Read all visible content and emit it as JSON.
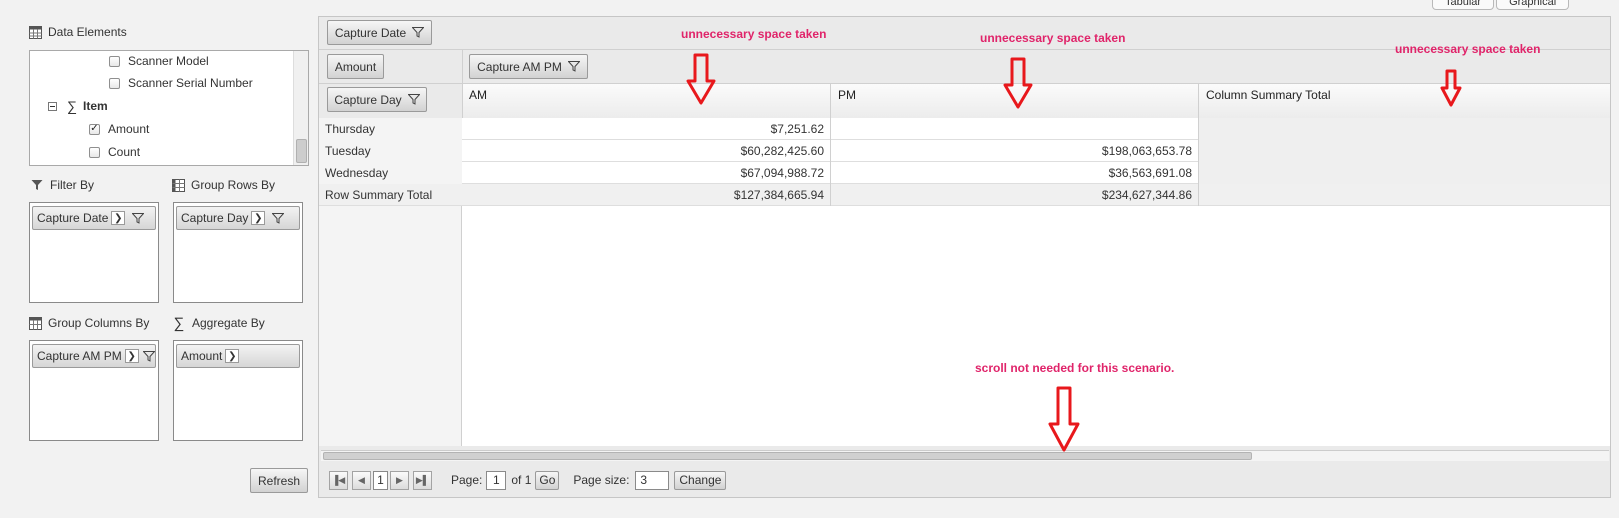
{
  "top_tabs": [
    "Tabular",
    "Graphical"
  ],
  "data_elements": {
    "title": "Data Elements",
    "items": [
      {
        "label": "Scanner Model",
        "checked": false
      },
      {
        "label": "Scanner Serial Number",
        "checked": false
      },
      {
        "label": "Item",
        "group": true
      },
      {
        "label": "Amount",
        "checked": true
      },
      {
        "label": "Count",
        "checked": false
      }
    ]
  },
  "filter_by": {
    "title": "Filter By",
    "chip": "Capture Date"
  },
  "group_rows_by": {
    "title": "Group Rows By",
    "chip": "Capture Day"
  },
  "group_columns_by": {
    "title": "Group Columns By",
    "chip": "Capture AM PM"
  },
  "aggregate_by": {
    "title": "Aggregate By",
    "chip": "Amount"
  },
  "refresh_label": "Refresh",
  "pivot": {
    "filter_chip": "Capture Date",
    "aggregate_chip": "Amount",
    "column_chip": "Capture AM PM",
    "row_chip": "Capture Day",
    "column_headers": [
      "AM",
      "PM",
      "Column Summary Total"
    ],
    "rows": [
      {
        "label": "Thursday",
        "am": "$7,251.62",
        "pm": ""
      },
      {
        "label": "Tuesday",
        "am": "$60,282,425.60",
        "pm": "$198,063,653.78"
      },
      {
        "label": "Wednesday",
        "am": "$67,094,988.72",
        "pm": "$36,563,691.08"
      },
      {
        "label": "Row Summary Total",
        "am": "$127,384,665.94",
        "pm": "$234,627,344.86"
      }
    ]
  },
  "pager": {
    "current_page": "1",
    "page_label": "Page:",
    "page_value": "1",
    "of_label": "of 1",
    "go_label": "Go",
    "page_size_label": "Page size:",
    "page_size_value": "3",
    "change_label": "Change"
  },
  "annotations": {
    "space1": "unnecessary space taken",
    "space2": "unnecessary space taken",
    "space3": "unnecessary space taken",
    "scroll": "scroll not needed for this scenario."
  },
  "colors": {
    "annotation": "#e0246a",
    "arrow": "#e8181c"
  }
}
